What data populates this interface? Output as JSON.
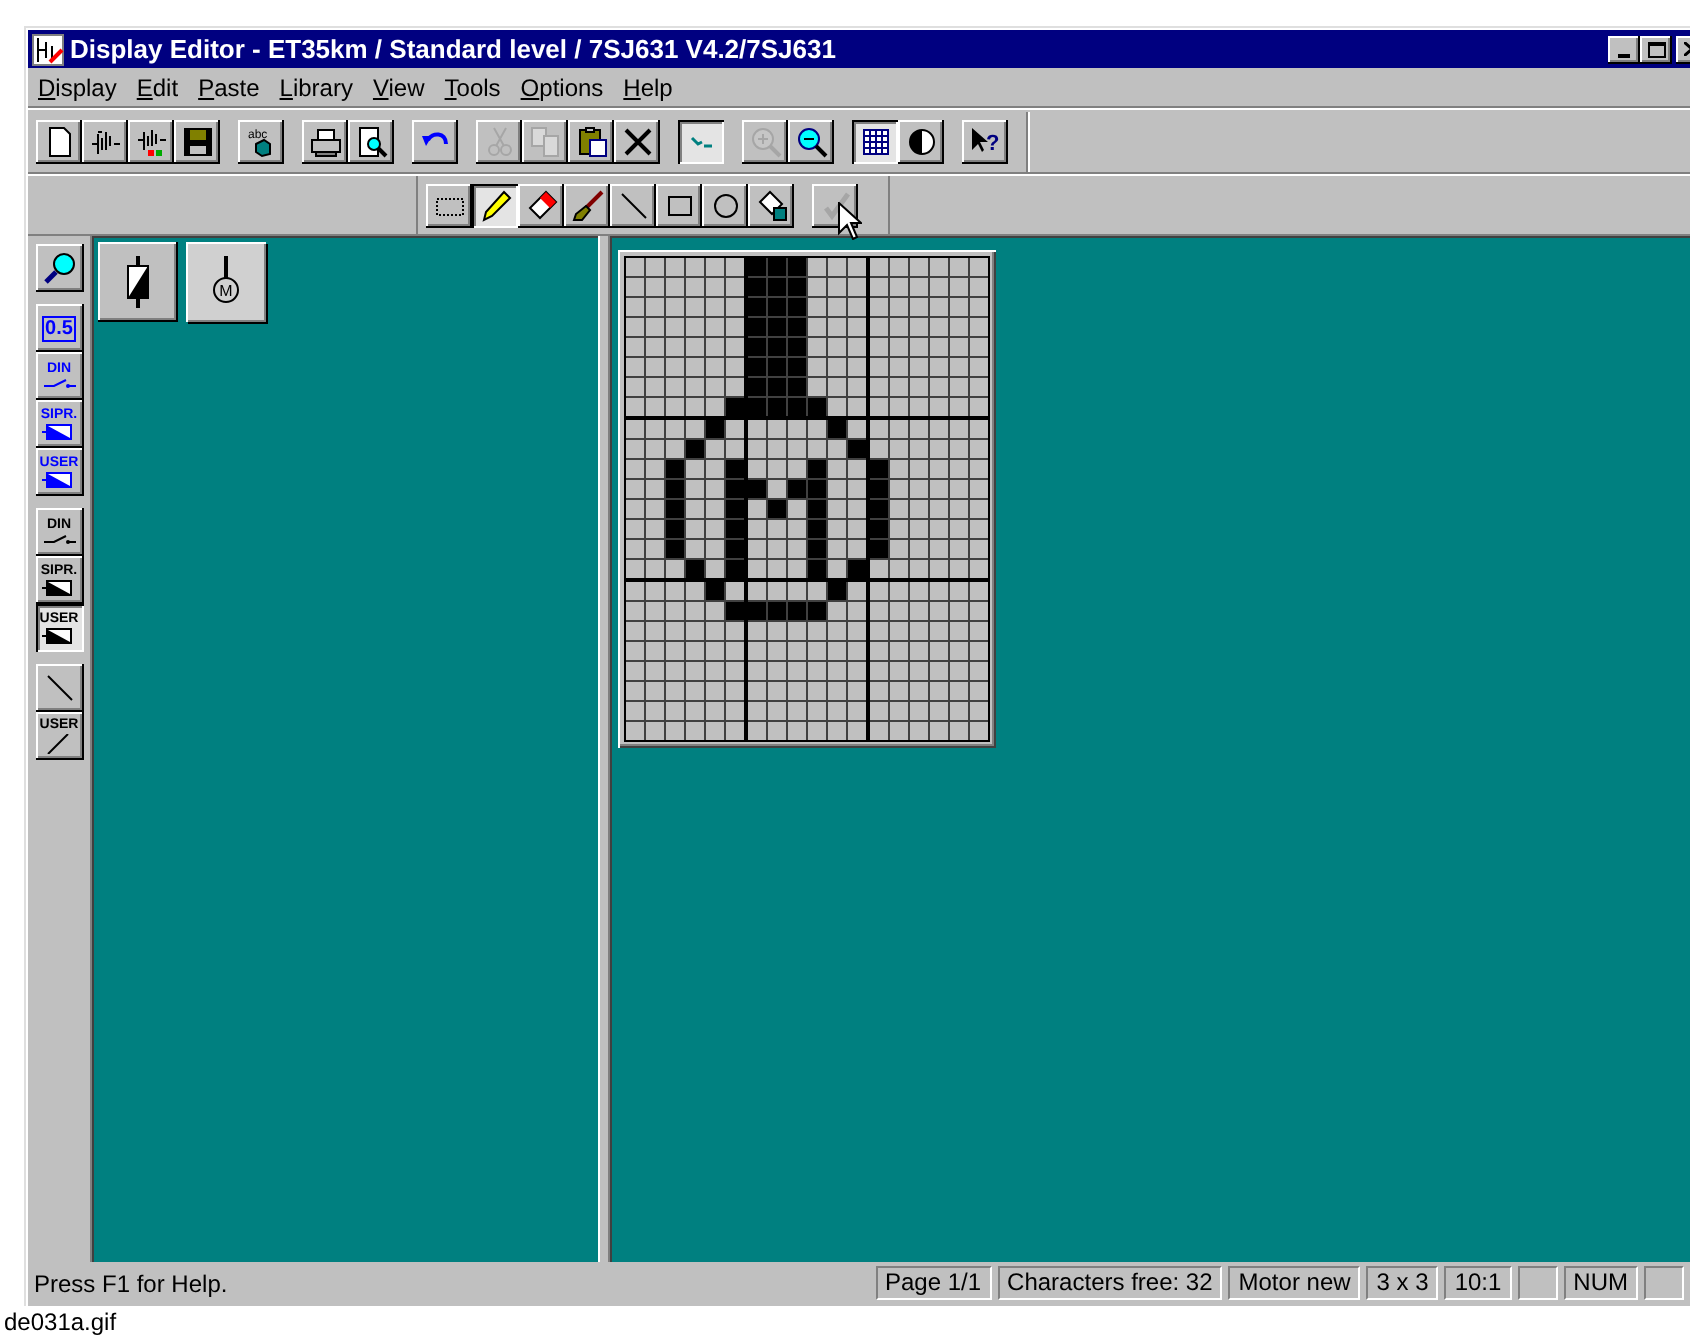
{
  "window": {
    "title": "Display Editor - ET35km / Standard level / 7SJ631 V4.2/7SJ631"
  },
  "menu": [
    "Display",
    "Edit",
    "Paste",
    "Library",
    "View",
    "Tools",
    "Options",
    "Help"
  ],
  "toolbar": [
    [
      {
        "kind": "new",
        "pressed": false,
        "disabled": false
      },
      {
        "kind": "import",
        "pressed": false,
        "disabled": false
      },
      {
        "kind": "import-color",
        "pressed": false,
        "disabled": false
      },
      {
        "kind": "save",
        "pressed": false,
        "disabled": false
      }
    ],
    [
      {
        "kind": "spell",
        "label": "abc",
        "pressed": false,
        "disabled": false
      }
    ],
    [
      {
        "kind": "print",
        "pressed": false,
        "disabled": false
      },
      {
        "kind": "preview",
        "pressed": false,
        "disabled": false
      }
    ],
    [
      {
        "kind": "undo",
        "pressed": false,
        "disabled": false
      }
    ],
    [
      {
        "kind": "cut",
        "pressed": false,
        "disabled": true
      },
      {
        "kind": "copy",
        "pressed": false,
        "disabled": true
      },
      {
        "kind": "paste",
        "pressed": false,
        "disabled": false
      },
      {
        "kind": "delete",
        "pressed": false,
        "disabled": false
      }
    ],
    [
      {
        "kind": "sketch",
        "pressed": true,
        "disabled": false
      }
    ],
    [
      {
        "kind": "zoom-in",
        "pressed": false,
        "disabled": true
      },
      {
        "kind": "zoom-out",
        "pressed": false,
        "disabled": false
      }
    ],
    [
      {
        "kind": "grid",
        "pressed": true,
        "disabled": false
      },
      {
        "kind": "contrast",
        "pressed": false,
        "disabled": false
      }
    ],
    [
      {
        "kind": "help",
        "label": "?",
        "pressed": false,
        "disabled": false
      }
    ]
  ],
  "drawing_tools": [
    [
      {
        "kind": "select",
        "pressed": false,
        "disabled": false
      },
      {
        "kind": "pencil",
        "pressed": true,
        "disabled": false
      },
      {
        "kind": "eraser",
        "pressed": false,
        "disabled": false
      },
      {
        "kind": "brush",
        "pressed": false,
        "disabled": false
      },
      {
        "kind": "line",
        "pressed": false,
        "disabled": false
      },
      {
        "kind": "rect",
        "pressed": false,
        "disabled": false
      },
      {
        "kind": "ellipse",
        "pressed": false,
        "disabled": false
      },
      {
        "kind": "fill",
        "pressed": false,
        "disabled": false
      }
    ],
    [
      {
        "kind": "apply",
        "pressed": false,
        "disabled": true
      }
    ]
  ],
  "side_tools": [
    [
      {
        "kind": "magnifier",
        "pressed": false
      }
    ],
    [
      {
        "kind": "value",
        "label": "0.5",
        "color": "#0000ff",
        "pressed": false
      },
      {
        "kind": "switch",
        "label": "DIN",
        "color": "#0000ff",
        "pressed": false
      },
      {
        "kind": "box",
        "label": "SIPR.",
        "color": "#0000ff",
        "pressed": false
      },
      {
        "kind": "box",
        "label": "USER",
        "color": "#0000ff",
        "pressed": false
      }
    ],
    [
      {
        "kind": "switch",
        "label": "DIN",
        "color": "#000000",
        "pressed": false
      },
      {
        "kind": "box",
        "label": "SIPR.",
        "color": "#000000",
        "pressed": false
      },
      {
        "kind": "box",
        "label": "USER",
        "color": "#000000",
        "pressed": true
      }
    ],
    [
      {
        "kind": "line",
        "pressed": false
      },
      {
        "kind": "user-line",
        "label": "USER",
        "pressed": false
      }
    ]
  ],
  "library": [
    {
      "kind": "capacitor",
      "selected": false
    },
    {
      "kind": "motor",
      "label": "M",
      "selected": true
    }
  ],
  "editor": {
    "grid": [
      [
        false,
        false,
        false,
        false,
        false,
        false,
        true,
        true,
        true,
        false,
        false,
        false,
        false,
        false,
        false,
        false,
        false,
        false
      ],
      [
        false,
        false,
        false,
        false,
        false,
        false,
        true,
        true,
        true,
        false,
        false,
        false,
        false,
        false,
        false,
        false,
        false,
        false
      ],
      [
        false,
        false,
        false,
        false,
        false,
        false,
        true,
        true,
        true,
        false,
        false,
        false,
        false,
        false,
        false,
        false,
        false,
        false
      ],
      [
        false,
        false,
        false,
        false,
        false,
        false,
        true,
        true,
        true,
        false,
        false,
        false,
        false,
        false,
        false,
        false,
        false,
        false
      ],
      [
        false,
        false,
        false,
        false,
        false,
        false,
        true,
        true,
        true,
        false,
        false,
        false,
        false,
        false,
        false,
        false,
        false,
        false
      ],
      [
        false,
        false,
        false,
        false,
        false,
        false,
        true,
        true,
        true,
        false,
        false,
        false,
        false,
        false,
        false,
        false,
        false,
        false
      ],
      [
        false,
        false,
        false,
        false,
        false,
        false,
        true,
        true,
        true,
        false,
        false,
        false,
        false,
        false,
        false,
        false,
        false,
        false
      ],
      [
        false,
        false,
        false,
        false,
        false,
        true,
        true,
        true,
        true,
        true,
        false,
        false,
        false,
        false,
        false,
        false,
        false,
        false
      ],
      [
        false,
        false,
        false,
        false,
        true,
        false,
        false,
        false,
        false,
        false,
        true,
        false,
        false,
        false,
        false,
        false,
        false,
        false
      ],
      [
        false,
        false,
        false,
        true,
        false,
        false,
        false,
        false,
        false,
        false,
        false,
        true,
        false,
        false,
        false,
        false,
        false,
        false
      ],
      [
        false,
        false,
        true,
        false,
        false,
        true,
        false,
        false,
        false,
        true,
        false,
        false,
        true,
        false,
        false,
        false,
        false,
        false
      ],
      [
        false,
        false,
        true,
        false,
        false,
        true,
        true,
        false,
        true,
        true,
        false,
        false,
        true,
        false,
        false,
        false,
        false,
        false
      ],
      [
        false,
        false,
        true,
        false,
        false,
        true,
        false,
        true,
        false,
        true,
        false,
        false,
        true,
        false,
        false,
        false,
        false,
        false
      ],
      [
        false,
        false,
        true,
        false,
        false,
        true,
        false,
        false,
        false,
        true,
        false,
        false,
        true,
        false,
        false,
        false,
        false,
        false
      ],
      [
        false,
        false,
        true,
        false,
        false,
        true,
        false,
        false,
        false,
        true,
        false,
        false,
        true,
        false,
        false,
        false,
        false,
        false
      ],
      [
        false,
        false,
        false,
        true,
        false,
        true,
        false,
        false,
        false,
        true,
        false,
        true,
        false,
        false,
        false,
        false,
        false,
        false
      ],
      [
        false,
        false,
        false,
        false,
        true,
        false,
        false,
        false,
        false,
        false,
        true,
        false,
        false,
        false,
        false,
        false,
        false,
        false
      ],
      [
        false,
        false,
        false,
        false,
        false,
        true,
        true,
        true,
        true,
        true,
        false,
        false,
        false,
        false,
        false,
        false,
        false,
        false
      ],
      [
        false,
        false,
        false,
        false,
        false,
        false,
        false,
        false,
        false,
        false,
        false,
        false,
        false,
        false,
        false,
        false,
        false,
        false
      ],
      [
        false,
        false,
        false,
        false,
        false,
        false,
        false,
        false,
        false,
        false,
        false,
        false,
        false,
        false,
        false,
        false,
        false,
        false
      ],
      [
        false,
        false,
        false,
        false,
        false,
        false,
        false,
        false,
        false,
        false,
        false,
        false,
        false,
        false,
        false,
        false,
        false,
        false
      ],
      [
        false,
        false,
        false,
        false,
        false,
        false,
        false,
        false,
        false,
        false,
        false,
        false,
        false,
        false,
        false,
        false,
        false,
        false
      ],
      [
        false,
        false,
        false,
        false,
        false,
        false,
        false,
        false,
        false,
        false,
        false,
        false,
        false,
        false,
        false,
        false,
        false,
        false
      ],
      [
        false,
        false,
        false,
        false,
        false,
        false,
        false,
        false,
        false,
        false,
        false,
        false,
        false,
        false,
        false,
        false,
        false,
        false
      ]
    ]
  },
  "status_bar": [
    {
      "kind": "text",
      "text": "Press F1 for Help."
    },
    {
      "kind": "text",
      "text": "Page 1/1"
    },
    {
      "kind": "text",
      "text": "Characters free: 32"
    },
    {
      "kind": "text",
      "text": "Motor new"
    },
    {
      "kind": "text",
      "text": "3 x 3"
    },
    {
      "kind": "text",
      "text": "10:1"
    },
    {
      "kind": "blank"
    },
    {
      "kind": "text",
      "text": "NUM"
    },
    {
      "kind": "blank"
    }
  ],
  "caption": "de031a.gif"
}
